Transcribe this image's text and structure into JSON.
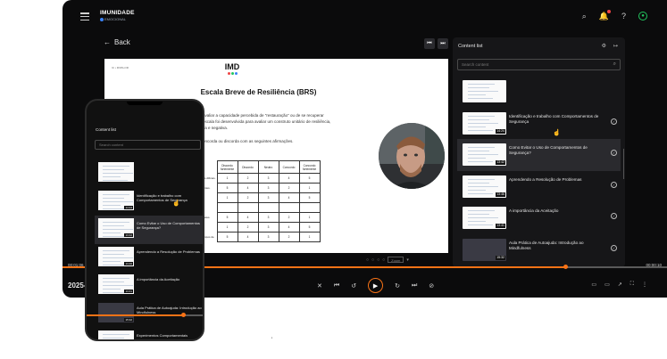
{
  "app": {
    "logo_top": "IMUNIDADE",
    "logo_sub": "EMOCIONAL"
  },
  "header": {
    "back_label": "Back"
  },
  "document": {
    "small_header": "IC • FINIS-OR",
    "logo_text": "IMD",
    "logo_dot_colors": [
      "#ef4444",
      "#22c55e",
      "#3b82f6"
    ],
    "title": "Escala Breve de Resiliência (BRS)",
    "para1_line1": "avaliar a capacidade percebida de \"restauração\" ou de se recuperar",
    "para1_line2": "escala foi desenvolvida para avaliar um construto unitário de resiliência,",
    "para1_line3": "va e negativa.",
    "para2": "oncorda ou discorda com as seguintes afirmações.",
    "table_headers": [
      "Discordo fortemente",
      "Discordo",
      "Neutro",
      "Concordo",
      "Concordo fortemente"
    ],
    "table_row_labels": [
      "s difíceis.",
      "ntes.",
      "",
      "",
      "eles.",
      "",
      "npos de"
    ],
    "table_rows": [
      [
        "1",
        "2",
        "3",
        "4",
        "5"
      ],
      [
        "5",
        "4",
        "3",
        "2",
        "1"
      ],
      [
        "1",
        "2",
        "3",
        "4",
        "5"
      ],
      [
        "",
        "",
        "",
        "",
        ""
      ],
      [
        "5",
        "4",
        "3",
        "2",
        "1"
      ],
      [
        "1",
        "2",
        "3",
        "4",
        "5"
      ],
      [
        "5",
        "4",
        "3",
        "2",
        "1"
      ]
    ],
    "zoom": "Zoom"
  },
  "sidebar": {
    "title": "Content list",
    "search_placeholder": "Search content",
    "items": [
      {
        "title": "",
        "duration": "",
        "thumb": "doc",
        "active": false
      },
      {
        "title": "Identificação e trabalho com Comportamentos de Segurança",
        "duration": "14:24",
        "thumb": "doc",
        "active": false
      },
      {
        "title": "Como Evitar o Uso de Comportamentos de Segurança?",
        "duration": "13:42",
        "thumb": "doc",
        "active": true
      },
      {
        "title": "Aprendendo a Resolução de Problemas",
        "duration": "13:46",
        "thumb": "doc",
        "active": false
      },
      {
        "title": "A importância da Aceitação",
        "duration": "13:41",
        "thumb": "doc",
        "active": false
      },
      {
        "title": "Aula Prática de Autoajuda: Introdução ao Mindfulness",
        "duration": "15:32",
        "thumb": "video",
        "active": false
      },
      {
        "title": "Experimentos Comportamentais",
        "duration": "",
        "thumb": "doc",
        "active": false
      }
    ]
  },
  "player": {
    "time_current": "00:01:06",
    "time_total": "00:00:10",
    "progress_fraction": 0.833,
    "title_prefix": "2025-",
    "accent": "#f97316"
  },
  "phone": {
    "title": "Content list",
    "search_placeholder": "Search content",
    "items": [
      {
        "title": "",
        "duration": "",
        "thumb": "doc",
        "active": false
      },
      {
        "title": "Identificação e trabalho com Comportamentos de Segurança",
        "duration": "14:24",
        "thumb": "doc",
        "active": false
      },
      {
        "title": "Como Evitar o Uso de Comportamentos de Segurança?",
        "duration": "13:42",
        "thumb": "doc",
        "active": true
      },
      {
        "title": "Aprendendo a Resolução de Problemas",
        "duration": "13:46",
        "thumb": "doc",
        "active": false
      },
      {
        "title": "A importância da Aceitação",
        "duration": "13:41",
        "thumb": "doc",
        "active": false
      },
      {
        "title": "Aula Prática de Autoajuda: Introdução ao Mindfulness",
        "duration": "15:32",
        "thumb": "video",
        "active": false
      },
      {
        "title": "Experimentos Comportamentais",
        "duration": "",
        "thumb": "doc",
        "active": false
      }
    ]
  }
}
